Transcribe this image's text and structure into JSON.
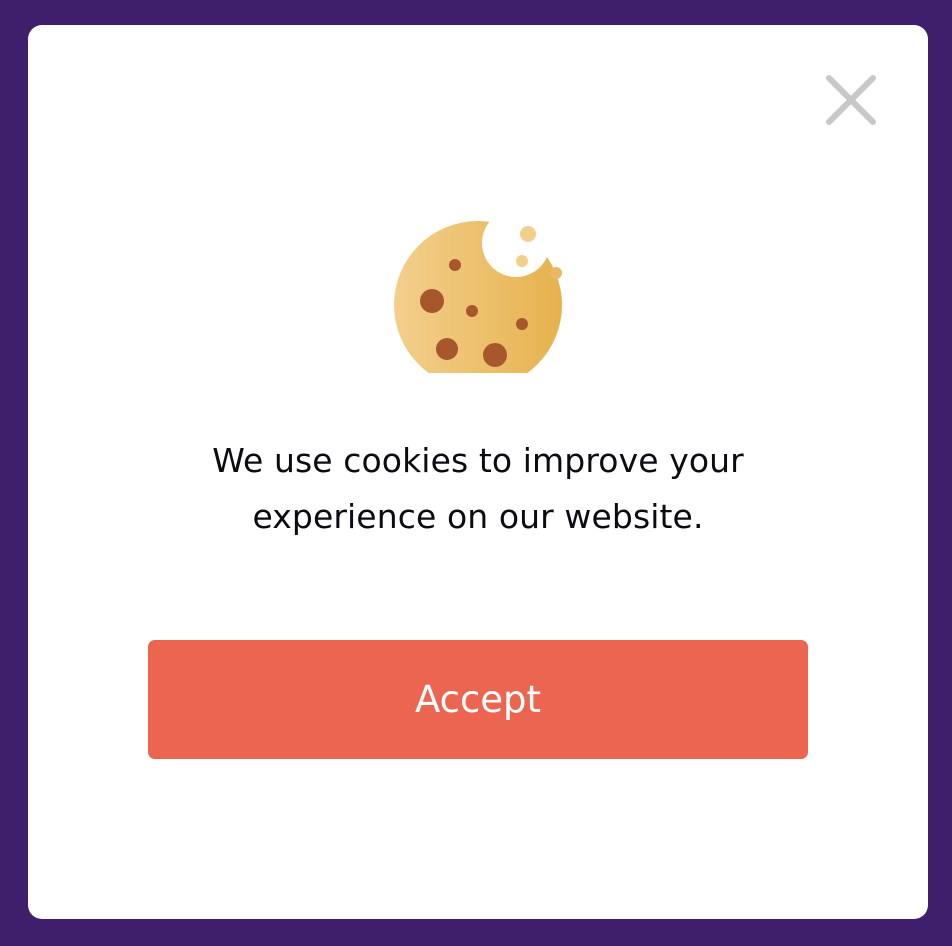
{
  "dialog": {
    "message": "We use cookies to improve your experience on our website.",
    "accept_label": "Accept",
    "close_icon": "close-icon",
    "illustration_icon": "cookie-icon"
  },
  "colors": {
    "backdrop": "#3f1f6b",
    "dialog_background": "#ffffff",
    "accept_button": "#ec6550",
    "accept_text": "#ffffff",
    "close_icon": "#c8c8c8",
    "message_text": "#0b0b12",
    "cookie_light": "#f3cf8c",
    "cookie_dark": "#e6b24e",
    "cookie_chips": "#a8572c"
  }
}
